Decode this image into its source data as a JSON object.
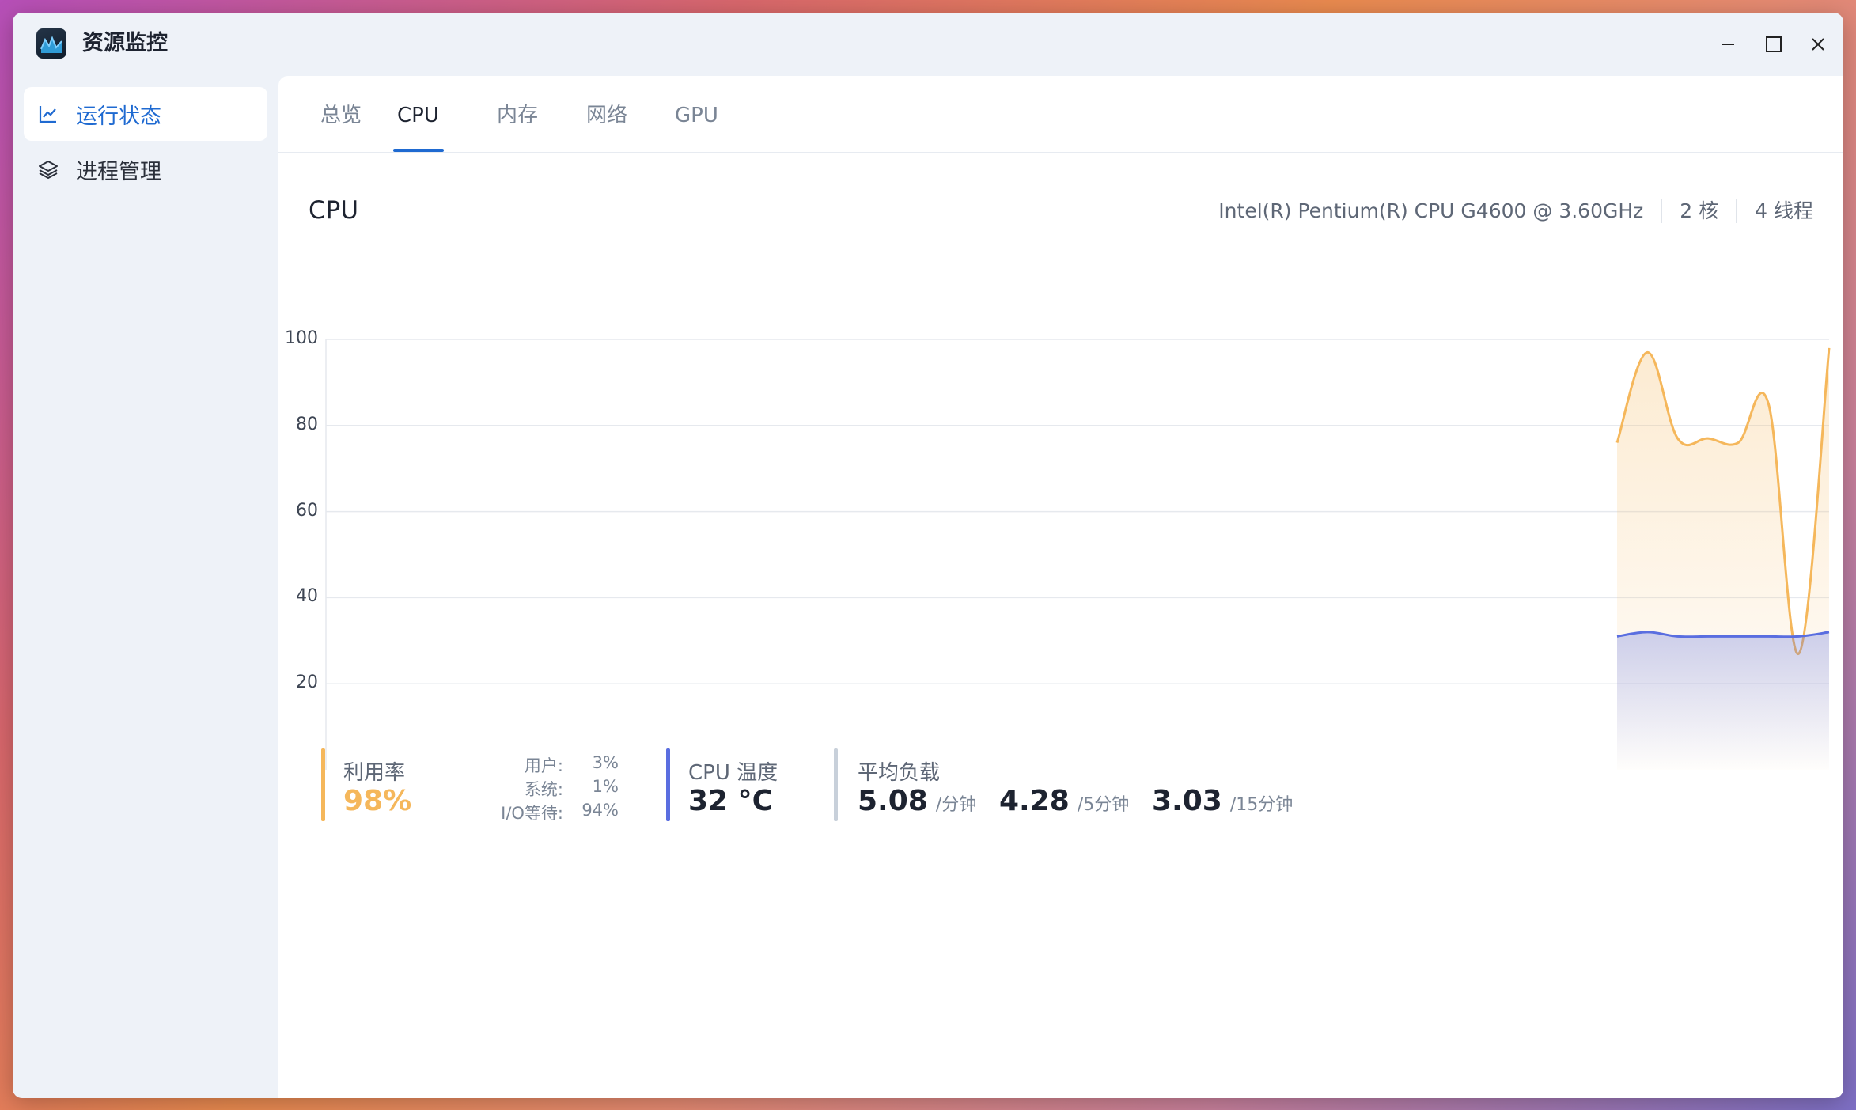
{
  "window": {
    "title": "资源监控"
  },
  "sidebar": {
    "items": [
      {
        "label": "运行状态",
        "icon": "line-chart-icon",
        "active": true
      },
      {
        "label": "进程管理",
        "icon": "layers-icon",
        "active": false
      }
    ]
  },
  "tabs": [
    {
      "label": "总览",
      "active": false
    },
    {
      "label": "CPU",
      "active": true
    },
    {
      "label": "内存",
      "active": false
    },
    {
      "label": "网络",
      "active": false
    },
    {
      "label": "GPU",
      "active": false
    }
  ],
  "section": {
    "title": "CPU",
    "model": "Intel(R) Pentium(R) CPU G4600 @ 3.60GHz",
    "cores": "2 核",
    "threads": "4 线程"
  },
  "colors": {
    "accent": "#1f6ad1",
    "usage": "#f5b75b",
    "temp": "#5a6ee0",
    "load": "#c8d0da"
  },
  "chart_data": {
    "type": "area",
    "y_ticks": [
      "100",
      "80",
      "60",
      "40",
      "20"
    ],
    "ylim": [
      0,
      100
    ],
    "grid": true,
    "series": [
      {
        "values": [
          76,
          97,
          77,
          77,
          76,
          85,
          27,
          98
        ]
      },
      {
        "values": [
          31,
          32,
          31,
          31,
          31,
          31,
          31,
          32
        ]
      }
    ]
  },
  "stats": {
    "usage": {
      "label": "利用率",
      "value": "98%",
      "breakdown": [
        {
          "key": "用户:",
          "value": "3%"
        },
        {
          "key": "系统:",
          "value": "1%"
        },
        {
          "key": "I/O等待:",
          "value": "94%"
        }
      ]
    },
    "temperature": {
      "label": "CPU 温度",
      "value": "32 °C"
    },
    "load": {
      "label": "平均负载",
      "items": [
        {
          "value": "5.08",
          "unit": "/分钟"
        },
        {
          "value": "4.28",
          "unit": "/5分钟"
        },
        {
          "value": "3.03",
          "unit": "/15分钟"
        }
      ]
    }
  }
}
